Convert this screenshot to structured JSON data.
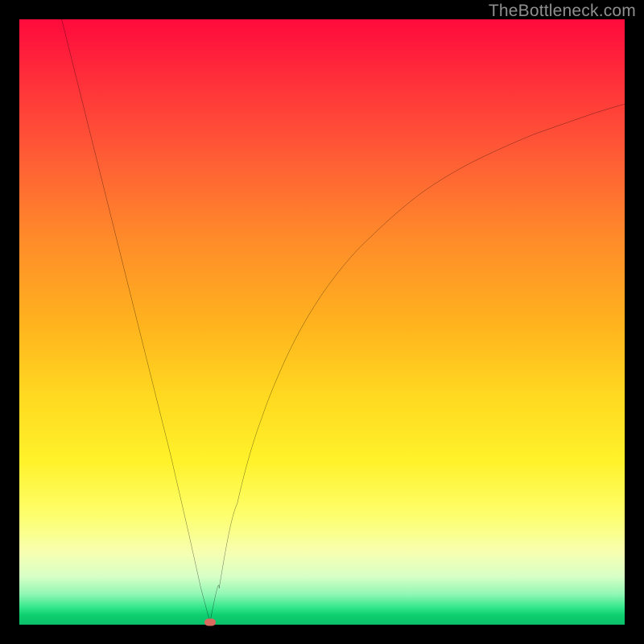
{
  "watermark": "TheBottleneck.com",
  "colors": {
    "frame": "#000000",
    "curve": "#000000",
    "vertex_dot": "#d86a5e",
    "gradient_stops": [
      "#ff0a3c",
      "#ff2f3a",
      "#ff5a36",
      "#ff8a2a",
      "#ffb21e",
      "#ffd820",
      "#fff22a",
      "#fdff6e",
      "#f7ffb0",
      "#d8ffc6",
      "#90f7b4",
      "#32e68a",
      "#0ecf70",
      "#0abf69"
    ]
  },
  "chart_data": {
    "type": "line",
    "title": "",
    "xlabel": "",
    "ylabel": "",
    "xlim": [
      0,
      100
    ],
    "ylim": [
      0,
      100
    ],
    "vertex": {
      "x": 31.5,
      "y": 0.4
    },
    "series": [
      {
        "name": "left-branch",
        "x": [
          7,
          10,
          13,
          16,
          19,
          22,
          25,
          28,
          30,
          31.5
        ],
        "y": [
          100,
          88,
          76,
          64,
          52,
          40,
          28,
          15,
          6,
          0.4
        ]
      },
      {
        "name": "right-branch",
        "x": [
          31.5,
          33,
          36,
          40,
          45,
          51,
          58,
          66,
          75,
          85,
          95,
          100
        ],
        "y": [
          0.4,
          6,
          20,
          34,
          46,
          56,
          64,
          71,
          76.5,
          81,
          84.5,
          86
        ]
      }
    ],
    "annotations": [
      {
        "name": "vertex-marker",
        "x": 31.5,
        "y": 0.4
      }
    ]
  }
}
